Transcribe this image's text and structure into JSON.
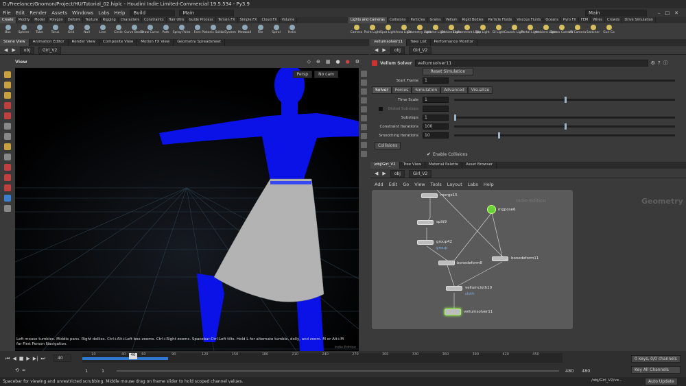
{
  "window": {
    "title": "D:/Freelance/Gnomon/Project/HU/Tutorial_02.hiplc - Houdini Indie Limited-Commercial 19.5.534 - Py3.9"
  },
  "menu": [
    "File",
    "Edit",
    "Render",
    "Assets",
    "Windows",
    "Labs",
    "Help"
  ],
  "desktop": {
    "build": "Build",
    "main_left": "Main",
    "main_right": "Main"
  },
  "shelf_tabs_left": [
    "Create",
    "Modify",
    "Model",
    "Polygon",
    "Deform",
    "Texture",
    "Rigging",
    "Characters",
    "Constraints",
    "Hair Utils",
    "Guide Process",
    "Terrain FX",
    "Simple FX",
    "Cloud FX",
    "Volume"
  ],
  "shelf_tabs_right": [
    "Lights and Cameras",
    "Collisions",
    "Particles",
    "Grains",
    "Vellum",
    "Rigid Bodies",
    "Particle Fluids",
    "Viscous Fluids",
    "Oceans",
    "Pyro FX",
    "FEM",
    "Wires",
    "Crowds",
    "Drive Simulation"
  ],
  "tools_left": [
    "Box",
    "Sphere",
    "Tube",
    "Torus",
    "Grid",
    "Null",
    "Line",
    "Circle",
    "Curve Bezier",
    "Draw Curve",
    "Path",
    "Spray Paint",
    "Font",
    "Platonic Solids",
    "L-System",
    "Metaball",
    "File",
    "Spiral",
    "Helix"
  ],
  "tools_right": [
    "Camera",
    "Point Light",
    "Spot Light",
    "Area Light",
    "Geometry Light",
    "Volume Light",
    "Distant Light",
    "Environment Light",
    "Sky Light",
    "GI Light",
    "Caustic Light",
    "Portal Light",
    "Ambient Light",
    "Stereo Camera",
    "VR Camera",
    "Switcher",
    "Gun Ca"
  ],
  "pane_tabs_left": [
    "Scene View",
    "Animation Editor",
    "Render View",
    "Composite View",
    "Motion FX View",
    "Geometry Spreadsheet"
  ],
  "pane_tabs_right_top": [
    "vellumsolver11",
    "Take List",
    "Performance Monitor"
  ],
  "pane_tabs_right_bottom": [
    "/obj/Girl_V2",
    "Tree View",
    "Material Palette",
    "Asset Browser"
  ],
  "path": {
    "obj": "obj",
    "object": "Girl_V2"
  },
  "viewport": {
    "title": "View",
    "persp": "Persp",
    "cam": "No cam",
    "hint": "Left mouse tumbles. Middle pans. Right dollies. Ctrl+Alt+Left box-zooms. Ctrl+Right zooms. Spacebar-Ctrl-Left tilts. Hold L for alternate tumble, dolly, and zoom.    M or Alt+M for First Person Navigation.",
    "watermark": "Indie Edition"
  },
  "parm": {
    "type": "Vellum Solver",
    "name": "vellumsolver11",
    "reset": "Reset Simulation",
    "start_frame_label": "Start Frame",
    "start_frame": "1",
    "tabs": [
      "Solver",
      "Forces",
      "Simulation",
      "Advanced",
      "Visualize"
    ],
    "rows": [
      {
        "label": "Time Scale",
        "value": "1",
        "fill": 0.5
      },
      {
        "label": "Global Substeps",
        "value": "",
        "fill": 0
      },
      {
        "label": "Substeps",
        "value": "1",
        "fill": 0
      },
      {
        "label": "Constraint Iterations",
        "value": "100",
        "fill": 0.5
      },
      {
        "label": "Smoothing Iterations",
        "value": "10",
        "fill": 0.2
      }
    ],
    "subtab": "Collisions",
    "checkbox_label": "Enable Collisions"
  },
  "network": {
    "menu": [
      "Add",
      "Edit",
      "Go",
      "View",
      "Tools",
      "Layout",
      "Labs",
      "Help"
    ],
    "context": "Geometry",
    "watermark": "Indie Edition",
    "nodes": [
      "merge15",
      "split9",
      "group42",
      "bonedeform8",
      "bonedeform11",
      "vellumcloth10",
      "vellumsolver11",
      "mgpose6"
    ],
    "sublabels": [
      "group",
      "cloth"
    ]
  },
  "timeline": {
    "frame": "40",
    "start": "1",
    "start2": "1",
    "end": "480",
    "end2": "480",
    "ticks": [
      "10",
      "40",
      "60",
      "90",
      "120",
      "150",
      "180",
      "210",
      "240",
      "270",
      "300",
      "330",
      "360",
      "390",
      "420",
      "450"
    ],
    "keys": "0 keys, 0/0 channels",
    "key_all": "Key All Channels",
    "auto": "Auto Update",
    "path": "/obj/Girl_V2/ve..."
  },
  "status": "Spacebar for viewing and unrestricted scrubbing. Middle mouse drag on frame slider to hold scoped channel values."
}
